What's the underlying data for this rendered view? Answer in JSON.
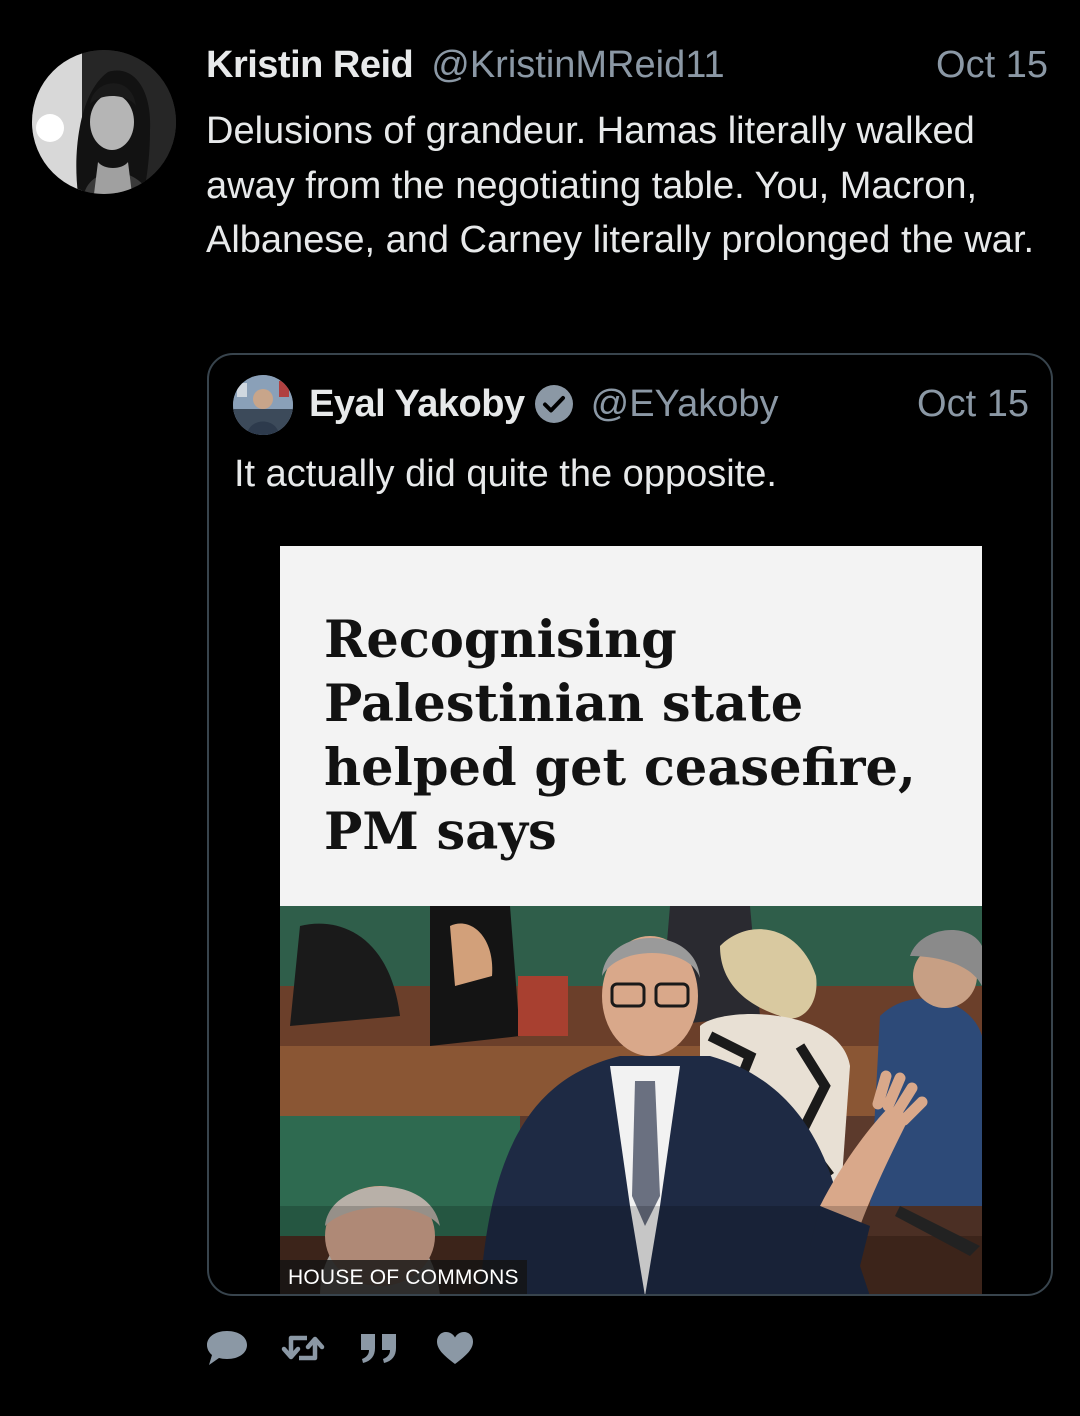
{
  "tweet": {
    "author": {
      "display_name": "Kristin Reid",
      "handle": "@KristinMReid11"
    },
    "date": "Oct 15",
    "text": "Delusions of grandeur. Hamas literally walked away from the negotiating table. You, Macron, Albanese, and Carney literally prolonged the war."
  },
  "quote": {
    "author": {
      "display_name": "Eyal Yakoby",
      "handle": "@EYakoby",
      "verified": true
    },
    "date": "Oct 15",
    "text": "It actually did quite the opposite.",
    "media": {
      "headline": "Recognising Palestinian state helped get ceasefire, PM says",
      "photo_caption": "HOUSE OF COMMONS"
    }
  },
  "actions": [
    {
      "icon": "reply-icon"
    },
    {
      "icon": "retweet-icon"
    },
    {
      "icon": "quote-icon"
    },
    {
      "icon": "like-icon"
    }
  ],
  "colors": {
    "background": "#000000",
    "text_primary": "#e7e9ea",
    "text_secondary": "#8b98a5",
    "border": "#38444d",
    "icon": "#8b98a5"
  }
}
